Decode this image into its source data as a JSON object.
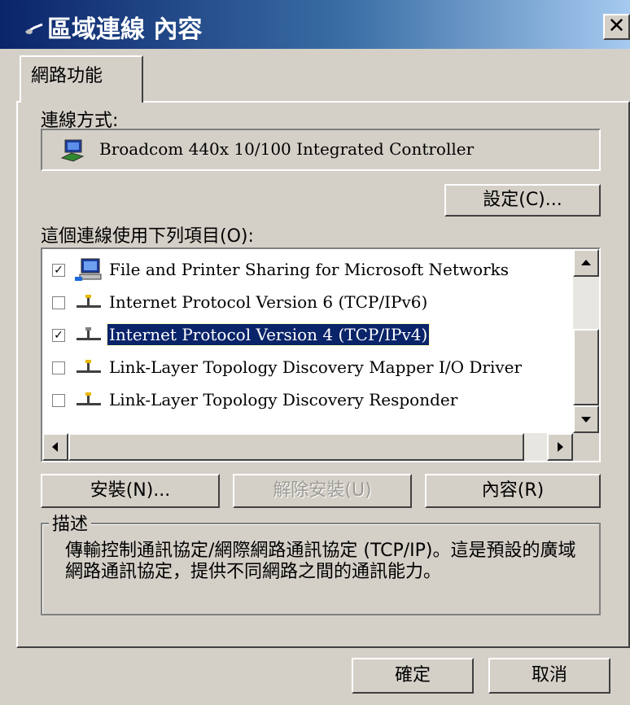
{
  "window": {
    "title": "區域連線 內容",
    "close_label": "✕"
  },
  "tab": {
    "label": "網路功能"
  },
  "connect_using": {
    "label": "連線方式:",
    "adapter": "Broadcom 440x 10/100 Integrated Controller"
  },
  "buttons": {
    "configure": "設定(C)...",
    "install": "安裝(N)...",
    "uninstall": "解除安裝(U)",
    "properties": "內容(R)",
    "ok": "確定",
    "cancel": "取消"
  },
  "items_label": "這個連線使用下列項目(O):",
  "items": [
    {
      "label": "File and Printer Sharing for Microsoft Networks",
      "checked": true,
      "icon": "network-computer-icon"
    },
    {
      "label": "Internet Protocol Version 6 (TCP/IPv6)",
      "checked": false,
      "icon": "protocol-icon"
    },
    {
      "label": "Internet Protocol Version 4 (TCP/IPv4)",
      "checked": true,
      "icon": "protocol-icon",
      "selected": true
    },
    {
      "label": "Link-Layer Topology Discovery Mapper I/O Driver",
      "checked": false,
      "icon": "protocol-icon"
    },
    {
      "label": "Link-Layer Topology Discovery Responder",
      "checked": false,
      "icon": "protocol-icon"
    }
  ],
  "description": {
    "legend": "描述",
    "text": "傳輸控制通訊協定/網際網路通訊協定 (TCP/IP)。這是預設的廣域網路通訊協定，提供不同網路之間的通訊能力。"
  },
  "colors": {
    "title_start": "#0b246a",
    "title_end": "#a6caf0",
    "selection": "#0a246a",
    "face": "#d4d0c8"
  }
}
